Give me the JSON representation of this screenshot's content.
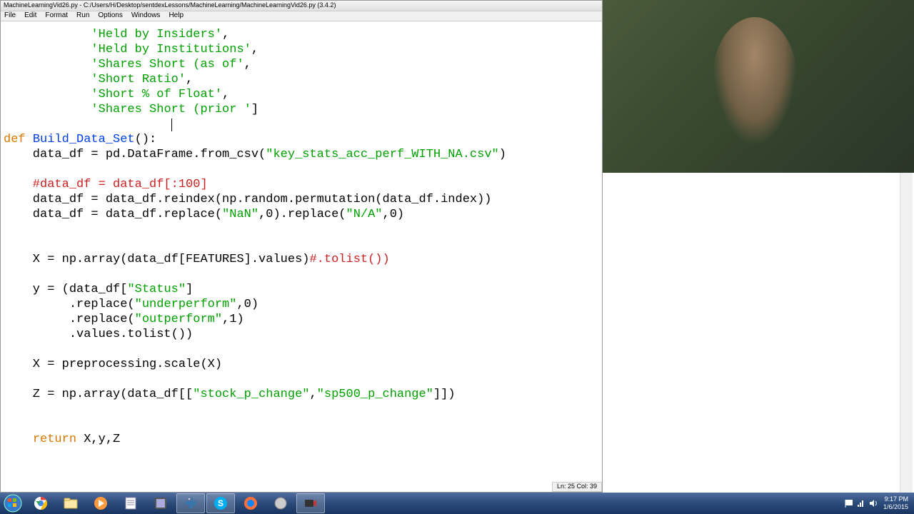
{
  "window": {
    "title": "MachineLearningVid26.py - C:/Users/H/Desktop/sentdexLessons/MachineLearning/MachineLearningVid26.py (3.4.2)"
  },
  "menu": {
    "file": "File",
    "edit": "Edit",
    "format": "Format",
    "run": "Run",
    "options": "Options",
    "windows": "Windows",
    "help": "Help"
  },
  "code": {
    "l1a": "            ",
    "l1s": "'Held by Insiders'",
    "l1b": ",",
    "l2a": "            ",
    "l2s": "'Held by Institutions'",
    "l2b": ",",
    "l3a": "            ",
    "l3s": "'Shares Short (as of'",
    "l3b": ",",
    "l4a": "            ",
    "l4s": "'Short Ratio'",
    "l4b": ",",
    "l5a": "            ",
    "l5s": "'Short % of Float'",
    "l5b": ",",
    "l6a": "            ",
    "l6s": "'Shares Short (prior '",
    "l6b": "]",
    "blank": "",
    "def_kw": "def",
    "def_sp": " ",
    "def_name": "Build_Data_Set",
    "def_tail": "():",
    "l9a": "    data_df = pd.DataFrame.from_csv(",
    "l9s": "\"key_stats_acc_perf_WITH_NA.csv\"",
    "l9b": ")",
    "l11": "    #data_df = data_df[:100]",
    "l12": "    data_df = data_df.reindex(np.random.permutation(data_df.index))",
    "l13a": "    data_df = data_df.replace(",
    "l13s1": "\"NaN\"",
    "l13b": ",0).replace(",
    "l13s2": "\"N/A\"",
    "l13c": ",0)",
    "l15a": "    X = np.array(data_df[FEATURES].values)",
    "l15c": "#.tolist())",
    "l17a": "    y = (data_df[",
    "l17s": "\"Status\"",
    "l17b": "]",
    "l18a": "         .replace(",
    "l18s": "\"underperform\"",
    "l18b": ",0)",
    "l19a": "         .replace(",
    "l19s": "\"outperform\"",
    "l19b": ",1)",
    "l20": "         .values.tolist())",
    "l22": "    X = preprocessing.scale(X)",
    "l24a": "    Z = np.array(data_df[[",
    "l24s1": "\"stock_p_change\"",
    "l24b": ",",
    "l24s2": "\"sp500_p_change\"",
    "l24c": "]])",
    "ret_sp": "    ",
    "ret_kw": "return",
    "ret_tail": " X,y,Z"
  },
  "status": {
    "pos": "Ln: 25 Col: 39"
  },
  "tray": {
    "time": "9:17 PM",
    "date": "1/6/2015"
  }
}
